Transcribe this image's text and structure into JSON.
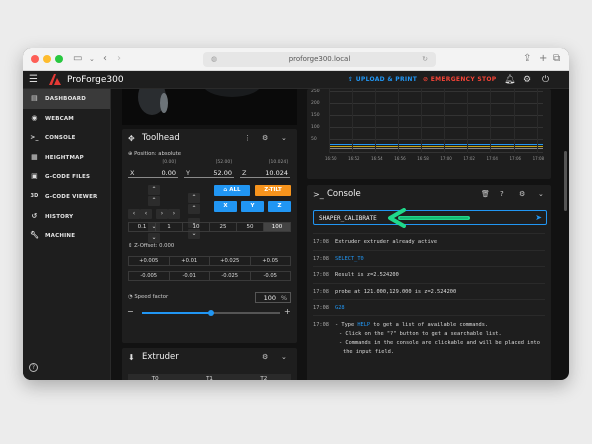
{
  "browser": {
    "url": "proforge300.local"
  },
  "app": {
    "name": "ProForge300"
  },
  "header": {
    "upload_label": "UPLOAD & PRINT",
    "estop_label": "EMERGENCY STOP"
  },
  "sidebar": {
    "items": [
      {
        "label": "DASHBOARD",
        "icon": "dashboard-icon"
      },
      {
        "label": "WEBCAM",
        "icon": "webcam-icon"
      },
      {
        "label": "CONSOLE",
        "icon": "console-icon"
      },
      {
        "label": "HEIGHTMAP",
        "icon": "heightmap-icon"
      },
      {
        "label": "G-CODE FILES",
        "icon": "files-icon"
      },
      {
        "label": "G-CODE VIEWER",
        "icon": "3d-icon"
      },
      {
        "label": "HISTORY",
        "icon": "history-icon"
      },
      {
        "label": "MACHINE",
        "icon": "wrench-icon"
      }
    ]
  },
  "toolhead": {
    "title": "Toolhead",
    "position_label": "Position: absolute",
    "axes": [
      {
        "label": "X",
        "value": "0.00",
        "sub": "[0.00]"
      },
      {
        "label": "Y",
        "value": "52.00",
        "sub": "[52.00]"
      },
      {
        "label": "Z",
        "value": "10.024",
        "sub": "[10.024]"
      }
    ],
    "home_all": "ALL",
    "ztilt": "Z-TILT",
    "home_x": "X",
    "home_y": "Y",
    "home_z": "Z",
    "steps": [
      "0.1",
      "1",
      "10",
      "25",
      "50",
      "100"
    ],
    "zoffset_label": "Z-Offset: 0.000",
    "zoffset_up": [
      "+0.005",
      "+0.01",
      "+0.025",
      "+0.05"
    ],
    "zoffset_down": [
      "-0.005",
      "-0.01",
      "-0.025",
      "-0.05"
    ],
    "speed_label": "Speed factor",
    "speed_value": "100",
    "speed_unit": "%",
    "speed_fraction": 0.5
  },
  "extruder": {
    "title": "Extruder",
    "columns": [
      "T0",
      "T1",
      "T2"
    ]
  },
  "temp_chart": {
    "y_ticks": [
      "250",
      "200",
      "150",
      "100",
      "50"
    ],
    "x_ticks": [
      "16:50",
      "16:52",
      "16:54",
      "16:56",
      "16:58",
      "17:00",
      "17:02",
      "17:04",
      "17:06",
      "17:08"
    ]
  },
  "console": {
    "title": "Console",
    "input_value": "SHAPER_CALIBRATE",
    "lines": [
      {
        "time": "17:08",
        "text": "Extruder extruder already active",
        "kind": "text"
      },
      {
        "time": "17:08",
        "text": "SELECT_T0",
        "kind": "cmd"
      },
      {
        "time": "17:08",
        "text": "Result is z=2.524200",
        "kind": "text"
      },
      {
        "time": "17:08",
        "text": "probe at 121.000,129.000 is z=2.524200",
        "kind": "text"
      },
      {
        "time": "17:08",
        "text": "G28",
        "kind": "cmd"
      }
    ],
    "help": {
      "time": "17:08",
      "pre": "- Type ",
      "kw": "HELP",
      "post": " to get a list of available commands.",
      "l2": "- Click on the \"?\" button to get a searchable list.",
      "l3": "- Commands in the console are clickable and will be placed into",
      "l4": "the input field."
    }
  },
  "colors": {
    "accent": "#2196f3",
    "orange": "#f7941d",
    "estop": "#f44336",
    "arrow": "#1fd88a"
  }
}
